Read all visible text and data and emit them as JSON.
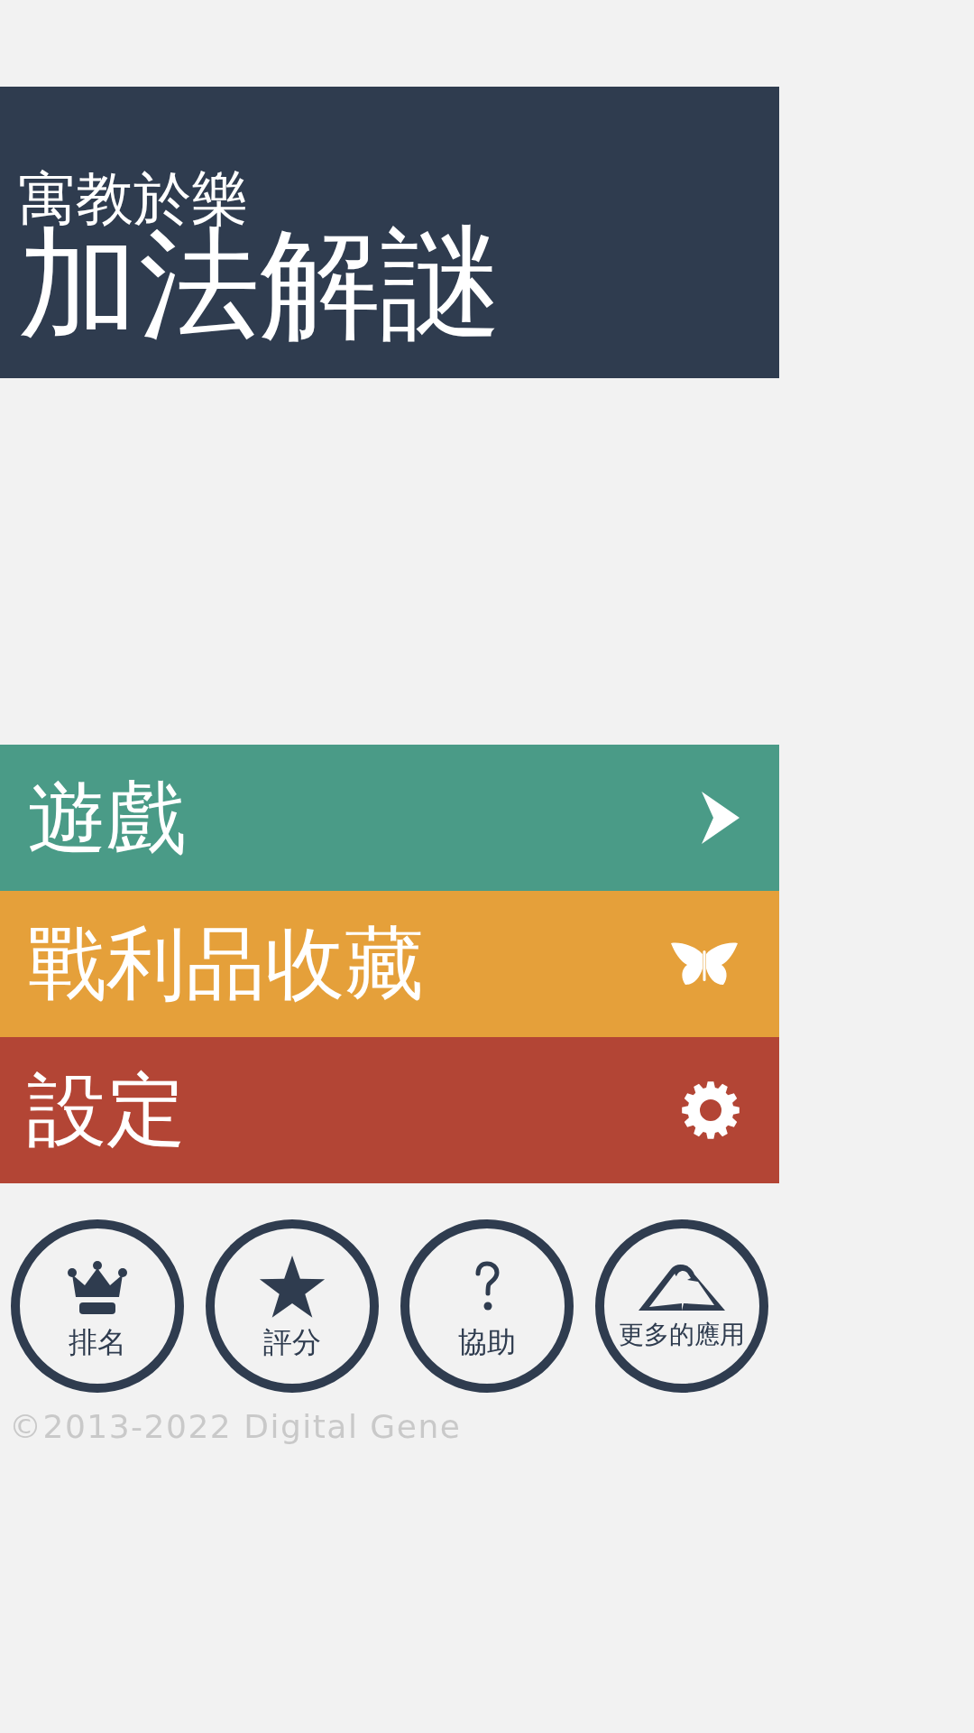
{
  "header": {
    "subtitle": "寓教於樂",
    "title": "加法解謎"
  },
  "menu": [
    {
      "label": "遊戲",
      "kind": "play",
      "color": "#4a9b87"
    },
    {
      "label": "戰利品收藏",
      "kind": "collection",
      "color": "#e5a03a"
    },
    {
      "label": "設定",
      "kind": "settings",
      "color": "#b34535"
    }
  ],
  "circle_buttons": [
    {
      "label": "排名",
      "kind": "ranking"
    },
    {
      "label": "評分",
      "kind": "rating"
    },
    {
      "label": "協助",
      "kind": "help"
    },
    {
      "label": "更多的應用",
      "kind": "more_apps"
    }
  ],
  "copyright": "©2013-2022 Digital Gene"
}
